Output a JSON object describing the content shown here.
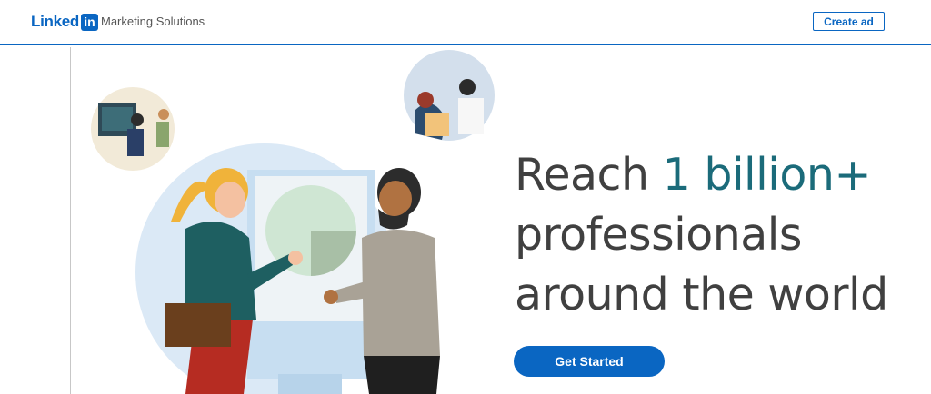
{
  "header": {
    "logo_word": "Linked",
    "logo_box": "in",
    "product": "Marketing Solutions",
    "create_ad_label": "Create ad"
  },
  "hero": {
    "headline_prefix": "Reach ",
    "headline_accent": "1 billion+",
    "headline_line2": "professionals",
    "headline_line3": "around the world",
    "cta_label": "Get Started"
  },
  "colors": {
    "brand": "#0a66c2",
    "accent_text": "#1b6b7a",
    "headline_text": "#404040"
  },
  "icons": {
    "logo": "linkedin-logo-icon",
    "illustration": "hero-illustration-people-presenting"
  }
}
